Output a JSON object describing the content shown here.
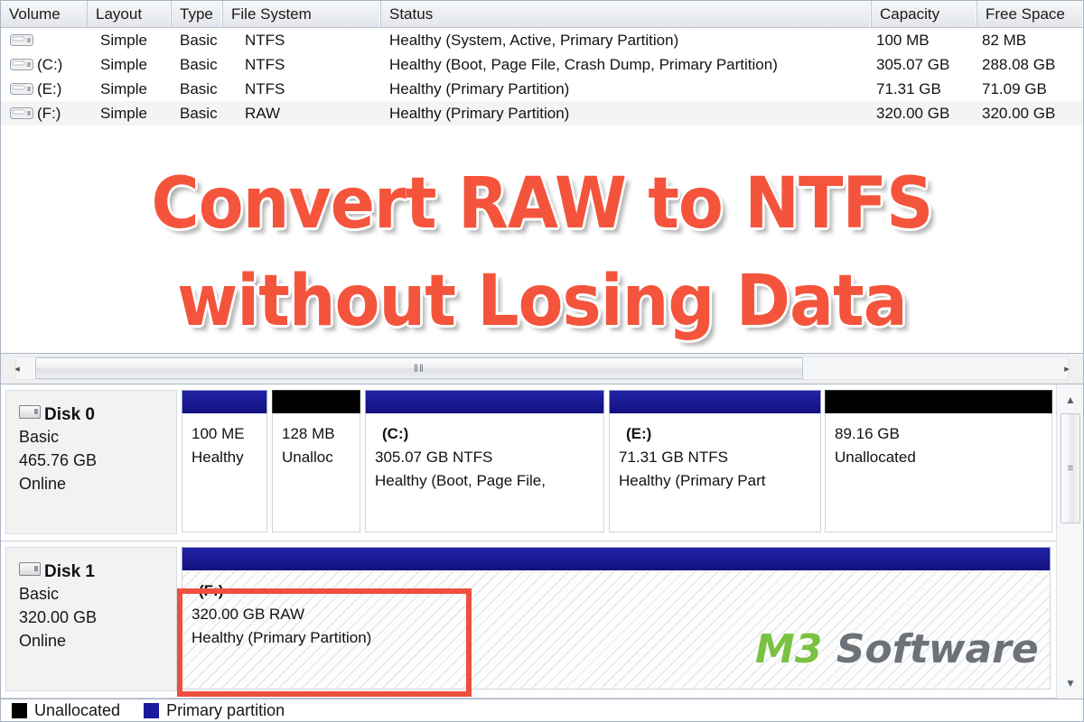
{
  "volume_table": {
    "columns": [
      "Volume",
      "Layout",
      "Type",
      "File System",
      "Status",
      "Capacity",
      "Free Space"
    ],
    "rows": [
      {
        "volume": "",
        "layout": "Simple",
        "type": "Basic",
        "file_system": "NTFS",
        "status": "Healthy (System, Active, Primary Partition)",
        "capacity": "100 MB",
        "free_space": "82 MB"
      },
      {
        "volume": "(C:)",
        "layout": "Simple",
        "type": "Basic",
        "file_system": "NTFS",
        "status": "Healthy (Boot, Page File, Crash Dump, Primary Partition)",
        "capacity": "305.07 GB",
        "free_space": "288.08 GB"
      },
      {
        "volume": "(E:)",
        "layout": "Simple",
        "type": "Basic",
        "file_system": "NTFS",
        "status": "Healthy (Primary Partition)",
        "capacity": "71.31 GB",
        "free_space": "71.09 GB"
      },
      {
        "volume": "(F:)",
        "layout": "Simple",
        "type": "Basic",
        "file_system": "RAW",
        "status": "Healthy (Primary Partition)",
        "capacity": "320.00 GB",
        "free_space": "320.00 GB"
      }
    ]
  },
  "scrollbars": {
    "h_left_arrow": "◂",
    "h_right_arrow": "▸",
    "h_grip": "‖‖",
    "v_up_arrow": "▲",
    "v_down_arrow": "▼",
    "v_grip": "≡"
  },
  "disks": [
    {
      "name": "Disk 0",
      "type": "Basic",
      "size": "465.76 GB",
      "state": "Online",
      "partitions": [
        {
          "kind": "primary",
          "letter": "",
          "size_fs": "100 ME",
          "status": "Healthy"
        },
        {
          "kind": "unallocated",
          "letter": "",
          "size_fs": "128 MB",
          "status": "Unalloc"
        },
        {
          "kind": "primary",
          "letter": "(C:)",
          "size_fs": "305.07 GB NTFS",
          "status": "Healthy (Boot, Page File,"
        },
        {
          "kind": "primary",
          "letter": "(E:)",
          "size_fs": "71.31 GB NTFS",
          "status": "Healthy (Primary Part"
        },
        {
          "kind": "unallocated",
          "letter": "",
          "size_fs": "89.16 GB",
          "status": "Unallocated"
        }
      ]
    },
    {
      "name": "Disk 1",
      "type": "Basic",
      "size": "320.00 GB",
      "state": "Online",
      "partitions": [
        {
          "kind": "raw",
          "letter": "(F:)",
          "size_fs": "320.00 GB RAW",
          "status": "Healthy (Primary Partition)"
        }
      ]
    }
  ],
  "legend": [
    {
      "label": "Unallocated",
      "color": "#000000"
    },
    {
      "label": "Primary partition",
      "color": "#1a1a9e"
    }
  ],
  "overlay": {
    "line1": "Convert RAW to NTFS",
    "line2": "without Losing Data",
    "color": "#f4543c"
  },
  "watermark": {
    "brand": "M3",
    "word": "Software",
    "brand_color": "#79c242",
    "word_color": "#6d7278"
  },
  "highlight": {
    "color": "#ef4f3f"
  }
}
